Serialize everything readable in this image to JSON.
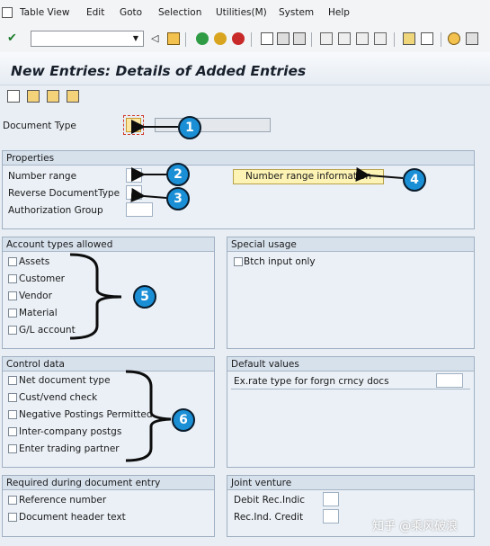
{
  "menu": {
    "items": [
      "Table View",
      "Edit",
      "Goto",
      "Selection",
      "Utilities(M)",
      "System",
      "Help"
    ]
  },
  "title": "New Entries: Details of Added Entries",
  "document_type": {
    "label": "Document Type"
  },
  "properties": {
    "header": "Properties",
    "number_range": "Number range",
    "reverse_doc_type": "Reverse DocumentType",
    "authorization_group": "Authorization Group",
    "number_range_info_button": "Number range information"
  },
  "account_types": {
    "header": "Account types allowed",
    "items": [
      "Assets",
      "Customer",
      "Vendor",
      "Material",
      "G/L account"
    ]
  },
  "special_usage": {
    "header": "Special usage",
    "items": [
      "Btch input only"
    ]
  },
  "control_data": {
    "header": "Control data",
    "items": [
      "Net document type",
      "Cust/vend check",
      "Negative Postings Permitted",
      "Inter-company postgs",
      "Enter trading partner"
    ]
  },
  "default_values": {
    "header": "Default values",
    "exchange_rate_type": "Ex.rate type for forgn crncy docs"
  },
  "required_entry": {
    "header": "Required during document entry",
    "items": [
      "Reference number",
      "Document header text"
    ]
  },
  "joint_venture": {
    "header": "Joint venture",
    "debit_rec_indic": "Debit Rec.Indic",
    "rec_ind_credit": "Rec.Ind. Credit"
  },
  "callouts": [
    "1",
    "2",
    "3",
    "4",
    "5",
    "6"
  ],
  "watermark": "知乎 @乘风破浪"
}
